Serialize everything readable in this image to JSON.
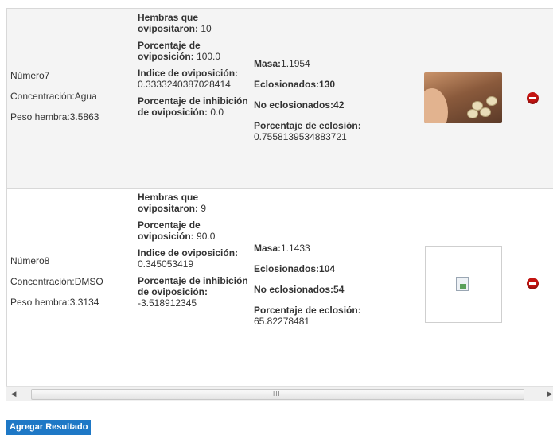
{
  "results": [
    {
      "numero": "Número7",
      "concentracion": "Concentración:Agua",
      "peso": "Peso hembra:3.5863",
      "hembras_label": "Hembras que ovipositaron:",
      "hembras_value": "10",
      "porc_ovip_label": "Porcentaje de oviposición:",
      "porc_ovip_value": "100.0",
      "indice_label": "Indice de oviposición:",
      "indice_value": "0.3333240387028414",
      "inhib_label": "Porcentaje de inhibición de oviposición:",
      "inhib_value": "0.0",
      "masa_label": "Masa:",
      "masa_value": "1.1954",
      "eclos_label": "Eclosionados:",
      "eclos_value": "130",
      "no_eclos_label": "No eclosionados:",
      "no_eclos_value": "42",
      "porc_eclos_label": "Porcentaje de eclosión:",
      "porc_eclos_value": "0.7558139534883721",
      "image": "tick-eggs-photo"
    },
    {
      "numero": "Número8",
      "concentracion": "Concentración:DMSO",
      "peso": "Peso hembra:3.3134",
      "hembras_label": "Hembras que ovipositaron:",
      "hembras_value": "9",
      "porc_ovip_label": "Porcentaje de oviposición:",
      "porc_ovip_value": "90.0",
      "indice_label": "Indice de oviposición:",
      "indice_value": "0.345053419",
      "inhib_label": "Porcentaje de inhibición de oviposición:",
      "inhib_value": "-3.518912345",
      "masa_label": "Masa:",
      "masa_value": "1.1433",
      "eclos_label": "Eclosionados:",
      "eclos_value": "104",
      "no_eclos_label": "No eclosionados:",
      "no_eclos_value": "54",
      "porc_eclos_label": "Porcentaje de eclosión:",
      "porc_eclos_value": "65.82278481",
      "image": "broken-image-icon"
    }
  ],
  "scrollbar": {
    "left_arrow": "◀",
    "right_arrow": "▶",
    "grip": "III"
  },
  "add_button_label": "Agregar Resultado",
  "colors": {
    "accent": "#1e78c6",
    "delete": "#c41411",
    "row_alt": "#f4f4f4"
  }
}
